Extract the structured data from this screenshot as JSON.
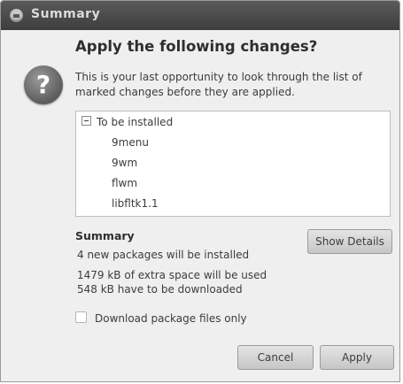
{
  "window": {
    "title": "Summary",
    "icon": "app-icon"
  },
  "dialog": {
    "icon": "question-icon",
    "heading": "Apply the following changes?",
    "description": "This is your last opportunity to look through the list of marked changes before they are applied."
  },
  "changes": {
    "group_label": "To be installed",
    "packages": [
      "9menu",
      "9wm",
      "flwm",
      "libfltk1.1"
    ]
  },
  "summary": {
    "title": "Summary",
    "lines": [
      "4 new packages will be installed",
      "1479 kB of extra space will be used",
      "548 kB have to be downloaded"
    ],
    "show_details_label": "Show Details"
  },
  "options": {
    "download_only_label": "Download package files only",
    "download_only_checked": false
  },
  "buttons": {
    "cancel_label": "Cancel",
    "apply_label": "Apply"
  }
}
